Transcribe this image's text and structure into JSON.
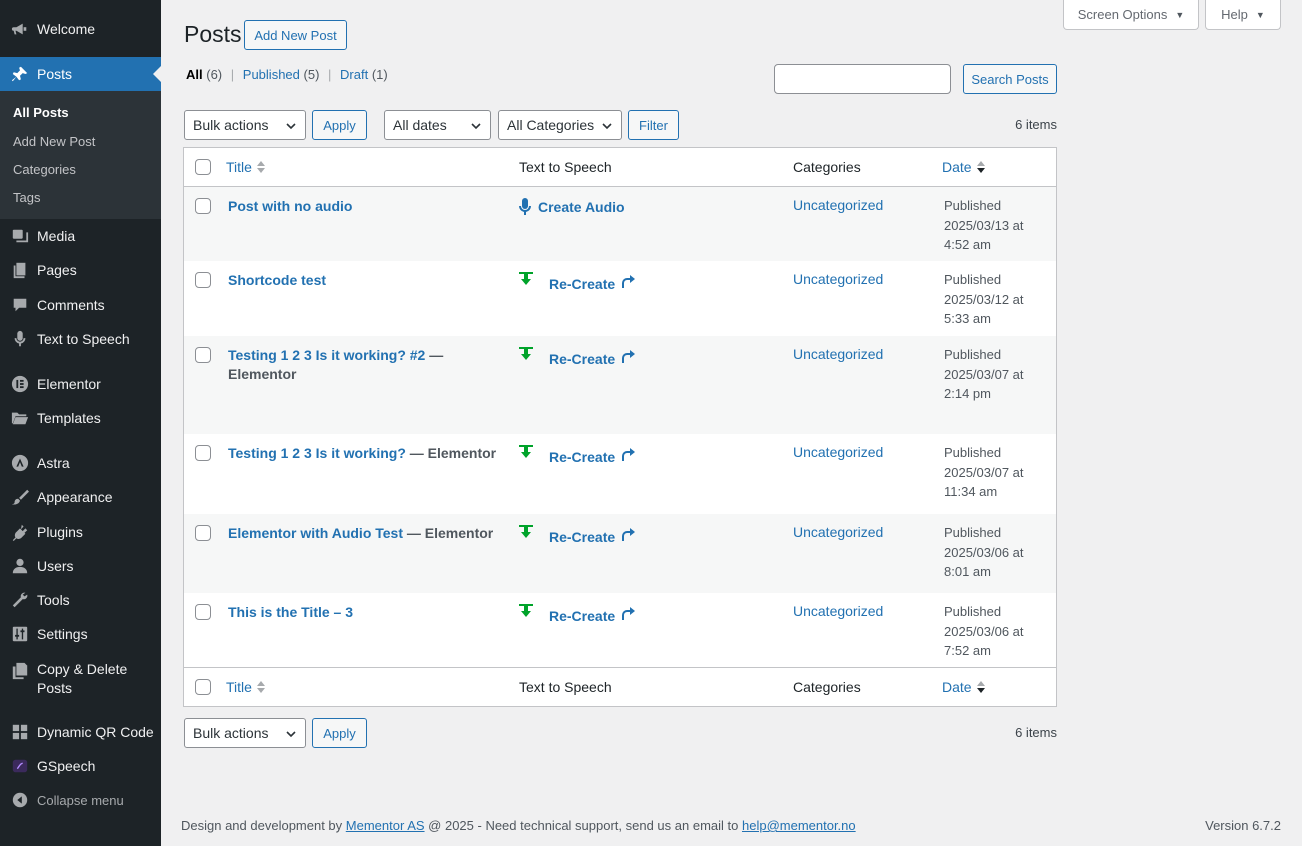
{
  "sidebar": {
    "welcome": "Welcome",
    "posts": "Posts",
    "submenu": [
      "All Posts",
      "Add New Post",
      "Categories",
      "Tags"
    ],
    "media": "Media",
    "pages": "Pages",
    "comments": "Comments",
    "text_to_speech": "Text to Speech",
    "elementor": "Elementor",
    "templates": "Templates",
    "astra": "Astra",
    "appearance": "Appearance",
    "plugins": "Plugins",
    "users": "Users",
    "tools": "Tools",
    "settings": "Settings",
    "copy_delete_1": "Copy & Delete",
    "copy_delete_2": "Posts",
    "dynamic_qr": "Dynamic QR Code",
    "gspeech": "GSpeech",
    "collapse": "Collapse menu"
  },
  "top": {
    "screen_options": "Screen Options",
    "help": "Help"
  },
  "header": {
    "title": "Posts",
    "add_new": "Add New Post"
  },
  "filters_links": {
    "all": "All",
    "all_count": "(6)",
    "published": "Published",
    "published_count": "(5)",
    "draft": "Draft",
    "draft_count": "(1)",
    "separator": "|"
  },
  "search": {
    "button": "Search Posts",
    "value": ""
  },
  "tablenav": {
    "bulk_actions": "Bulk actions",
    "apply": "Apply",
    "dates": "All dates",
    "categories": "All Categories",
    "filter": "Filter",
    "items": "6 items"
  },
  "columns": {
    "title": "Title",
    "tts": "Text to Speech",
    "categories": "Categories",
    "date": "Date"
  },
  "rows": [
    {
      "title": "Post with no audio",
      "state": "",
      "tts": "Create Audio",
      "tts_type": "create",
      "category": "Uncategorized",
      "status": "Published",
      "date": "2025/03/13 at",
      "time": "4:52 am"
    },
    {
      "title": "Shortcode test",
      "state": "",
      "tts": "Re-Create",
      "tts_type": "recreate",
      "category": "Uncategorized",
      "status": "Published",
      "date": "2025/03/12 at",
      "time": "5:33 am"
    },
    {
      "title": "Testing 1 2 3 Is it working? #2",
      "state": " — Elementor",
      "tts": "Re-Create",
      "tts_type": "recreate",
      "category": "Uncategorized",
      "status": "Published",
      "date": "2025/03/07 at",
      "time": "2:14 pm"
    },
    {
      "title": "Testing 1 2 3 Is it working?",
      "state": " — Elementor",
      "tts": "Re-Create",
      "tts_type": "recreate",
      "category": "Uncategorized",
      "status": "Published",
      "date": "2025/03/07 at",
      "time": "11:34 am"
    },
    {
      "title": "Elementor with Audio Test",
      "state": " — Elementor",
      "tts": "Re-Create",
      "tts_type": "recreate",
      "category": "Uncategorized",
      "status": "Published",
      "date": "2025/03/06 at",
      "time": "8:01 am"
    },
    {
      "title": "This is the Title – 3",
      "state": "",
      "tts": "Re-Create",
      "tts_type": "recreate",
      "category": "Uncategorized",
      "status": "Published",
      "date": "2025/03/06 at",
      "time": "7:52 am"
    }
  ],
  "footer": {
    "prefix": "Design and development by ",
    "company": "Mementor AS",
    "middle": " @ 2025 - Need technical support, send us an email to ",
    "email": "help@mementor.no",
    "version": "Version 6.7.2"
  },
  "colors": {
    "sidebar_bg": "#1d2327",
    "accent": "#2271b1",
    "tts_green": "#00a32a"
  }
}
